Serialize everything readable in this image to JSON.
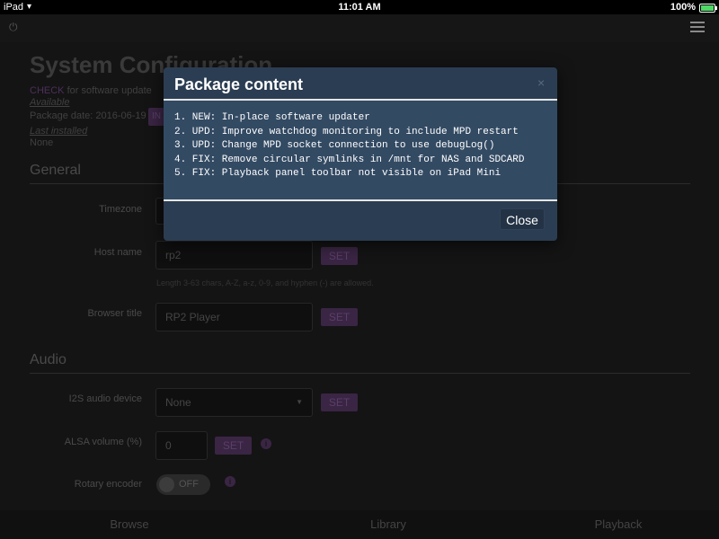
{
  "status_bar": {
    "device": "iPad",
    "time": "11:01 AM",
    "battery": "100%"
  },
  "icons": {
    "top_left": "power-icon",
    "top_right": "hamburger-menu-icon"
  },
  "page": {
    "title": "System Configuration",
    "check_link": "CHECK",
    "check_text": "for software update",
    "available_label": "Available",
    "package_date": "Package date: 2016-06-19",
    "install_button": "IN",
    "last_installed_label": "Last installed",
    "last_installed_value": "None",
    "general": {
      "heading": "General",
      "timezone_label": "Timezone",
      "hostname_label": "Host name",
      "hostname_value": "rp2",
      "hostname_set": "SET",
      "hostname_help": "Length 3-63 chars, A-Z, a-z, 0-9, and hyphen (-) are allowed.",
      "browser_title_label": "Browser title",
      "browser_title_value": "RP2 Player",
      "browser_title_set": "SET"
    },
    "audio": {
      "heading": "Audio",
      "i2s_label": "I2S audio device",
      "i2s_value": "None",
      "i2s_set": "SET",
      "alsa_label": "ALSA volume (%)",
      "alsa_value": "0",
      "alsa_set": "SET",
      "rotary_label": "Rotary encoder",
      "rotary_value": "OFF"
    }
  },
  "bottom_nav": {
    "browse": "Browse",
    "library": "Library",
    "playback": "Playback"
  },
  "modal": {
    "title": "Package content",
    "close_x": "×",
    "items": [
      "1. NEW: In-place software updater",
      "2. UPD: Improve watchdog monitoring to include MPD restart",
      "3. UPD: Change MPD socket connection to use debugLog()",
      "4. FIX: Remove circular symlinks in /mnt for NAS and SDCARD",
      "5. FIX: Playback panel toolbar not visible on iPad Mini"
    ],
    "close_button": "Close"
  }
}
